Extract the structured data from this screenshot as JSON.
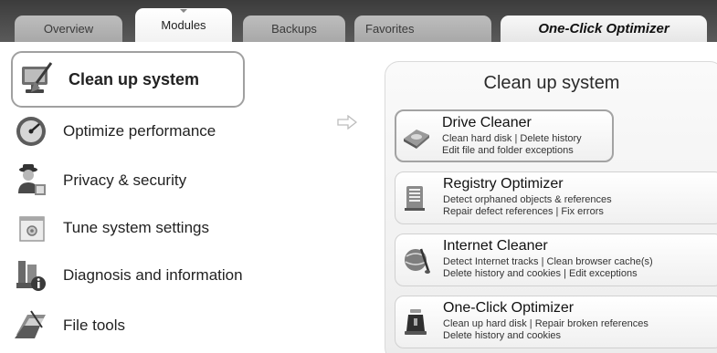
{
  "tabs": [
    {
      "label": "Overview"
    },
    {
      "label": "Modules"
    },
    {
      "label": "Backups"
    },
    {
      "label": "Favorites"
    },
    {
      "label": "One-Click Optimizer"
    }
  ],
  "nav": {
    "items": [
      {
        "label": "Clean up system",
        "icon": "computer-cleanup-icon"
      },
      {
        "label": "Optimize performance",
        "icon": "speedometer-icon"
      },
      {
        "label": "Privacy & security",
        "icon": "privacy-agent-icon"
      },
      {
        "label": "Tune system settings",
        "icon": "settings-window-icon"
      },
      {
        "label": "Diagnosis and information",
        "icon": "diagnosis-info-icon"
      },
      {
        "label": "File tools",
        "icon": "file-tools-icon"
      }
    ]
  },
  "panel": {
    "title": "Clean up system",
    "cards": [
      {
        "title": "Drive Cleaner",
        "line1": "Clean hard disk | Delete history",
        "line2": "Edit file and folder exceptions",
        "icon": "drive-cleaner-icon"
      },
      {
        "title": "Registry Optimizer",
        "line1": "Detect orphaned objects & references",
        "line2": "Repair defect references | Fix errors",
        "icon": "registry-optimizer-icon"
      },
      {
        "title": "Internet Cleaner",
        "line1": "Detect Internet tracks | Clean browser cache(s)",
        "line2": "Delete history and cookies | Edit exceptions",
        "icon": "internet-cleaner-icon"
      },
      {
        "title": "One-Click Optimizer",
        "line1": "Clean up hard disk | Repair broken references",
        "line2": "Delete history and cookies",
        "icon": "one-click-optimizer-icon"
      }
    ]
  }
}
